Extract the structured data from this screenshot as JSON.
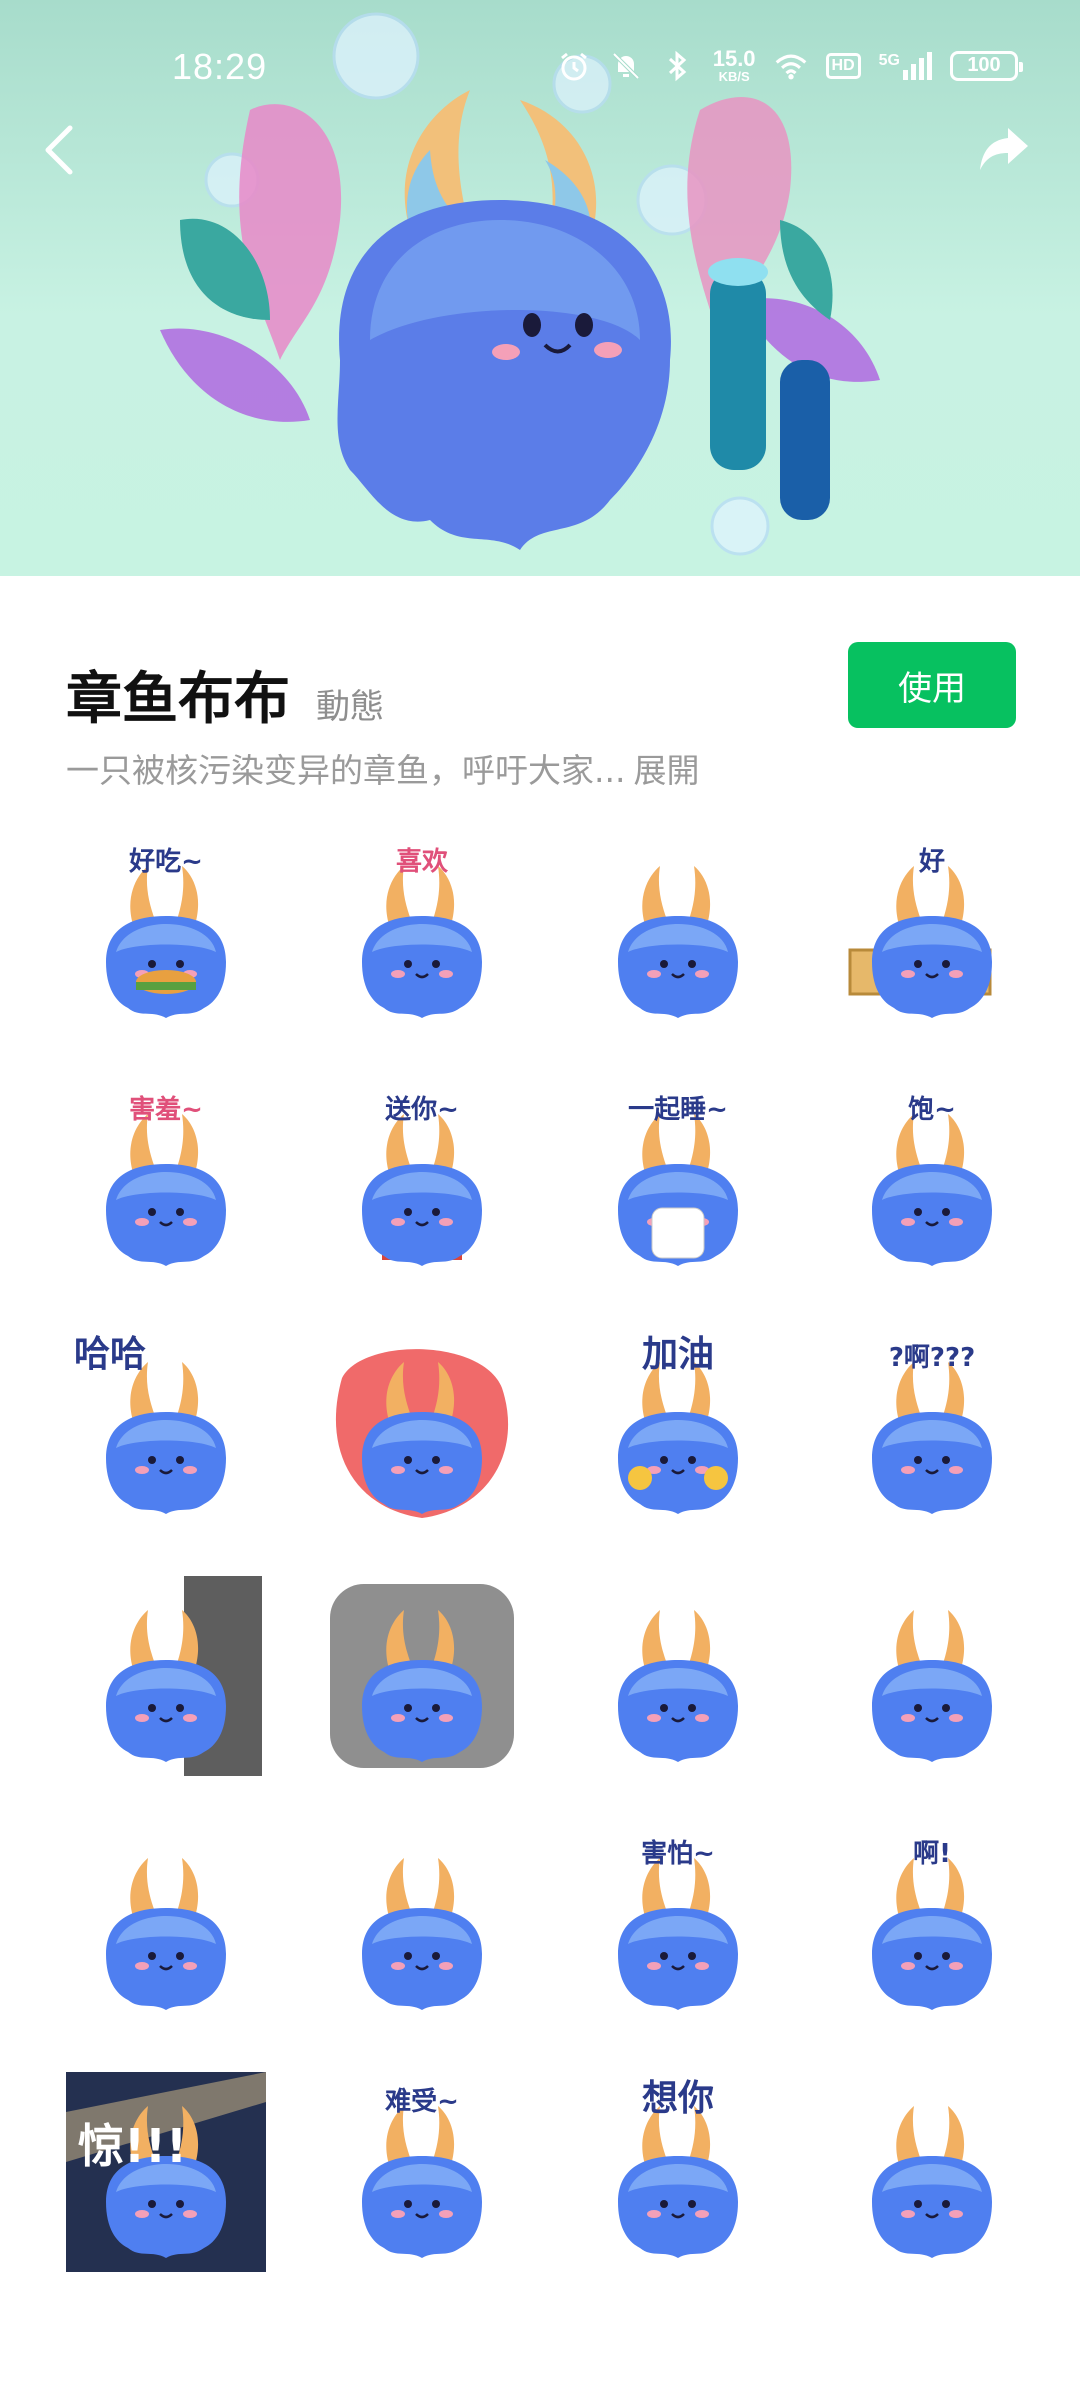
{
  "status_bar": {
    "time": "18:29",
    "net_speed_value": "15.0",
    "net_speed_unit": "KB/S",
    "hd_label": "HD",
    "signal_label": "5G",
    "battery": "100"
  },
  "nav": {
    "back_icon": "chevron-left-icon",
    "share_icon": "share-arrow-icon"
  },
  "pack": {
    "title": "章鱼布布",
    "type_label": "動態",
    "use_button": "使用",
    "description": "一只被核污染变异的章鱼，呼吁大家...",
    "expand_label": "展開",
    "accent_color": "#07c160"
  },
  "stickers": [
    {
      "caption": "好吃~"
    },
    {
      "caption": "喜欢"
    },
    {
      "caption": ""
    },
    {
      "caption": "好"
    },
    {
      "caption": "害羞~"
    },
    {
      "caption": "送你~"
    },
    {
      "caption": "一起睡~"
    },
    {
      "caption": "饱~"
    },
    {
      "caption": "哈哈"
    },
    {
      "caption": ""
    },
    {
      "caption": "加油"
    },
    {
      "caption": "?啊???"
    },
    {
      "caption": ""
    },
    {
      "caption": ""
    },
    {
      "caption": ""
    },
    {
      "caption": ""
    },
    {
      "caption": ""
    },
    {
      "caption": ""
    },
    {
      "caption": "害怕~"
    },
    {
      "caption": "啊!"
    },
    {
      "caption": "惊!!!"
    },
    {
      "caption": "难受~"
    },
    {
      "caption": "想你"
    },
    {
      "caption": ""
    }
  ]
}
